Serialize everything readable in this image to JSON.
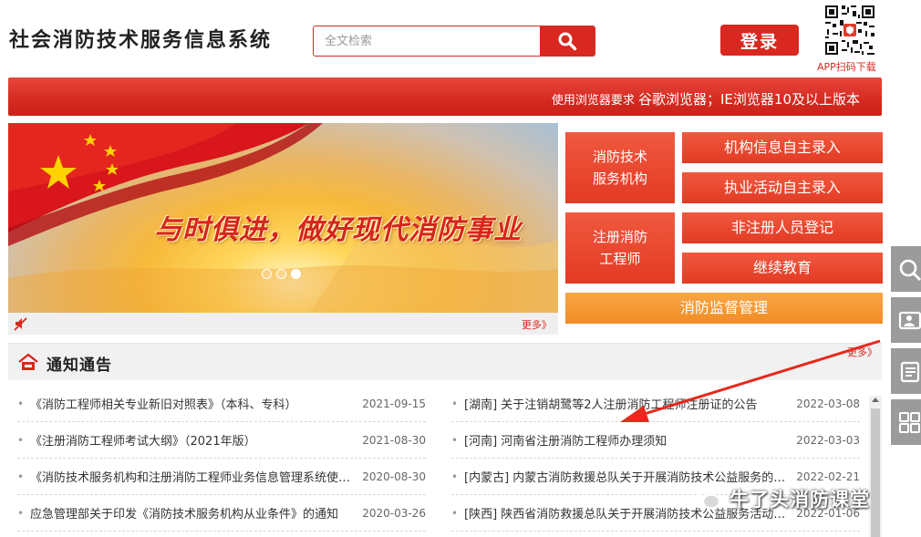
{
  "header": {
    "site_title": "社会消防技术服务信息系统",
    "search_placeholder": "全文检索",
    "login_label": "登录",
    "qr_caption": "APP扫码下载"
  },
  "banner": {
    "prefix": "使用浏览器要求",
    "browser": "谷歌浏览器",
    "suffix": "；IE浏览器10及以上版本"
  },
  "slider": {
    "slogan": "与时俱进，做好现代消防事业",
    "slide_count": 3,
    "active_index": 2,
    "more_label": "更多》"
  },
  "menu": {
    "org_group": "消防技术服务机构",
    "engineer_group": "注册消防工程师",
    "items": [
      "机构信息自主录入",
      "执业活动自主录入",
      "非注册人员登记",
      "继续教育"
    ],
    "supervision": "消防监督管理"
  },
  "notices": {
    "title": "通知通告",
    "more_label": "更多》",
    "left": [
      {
        "title": "《消防工程师相关专业新旧对照表》（本科、专科）",
        "date": "2021-09-15"
      },
      {
        "title": "《注册消防工程师考试大纲》（2021年版）",
        "date": "2021-08-30"
      },
      {
        "title": "《消防技术服务机构和注册消防工程师业务信息管理系统使用手册》",
        "date": "2020-08-30"
      },
      {
        "title": "应急管理部关于印发《消防技术服务机构从业条件》的通知",
        "date": "2020-03-26"
      }
    ],
    "right": [
      {
        "title": "[湖南] 关于注销胡鹭等2人注册消防工程师注册证的公告",
        "date": "2022-03-08"
      },
      {
        "title": "[河南] 河南省注册消防工程师办理须知",
        "date": "2022-03-03"
      },
      {
        "title": "[内蒙古] 内蒙古消防救援总队关于开展消防技术公益服务的通知",
        "date": "2022-02-21"
      },
      {
        "title": "[陕西] 陕西省消防救援总队关于开展消防技术公益服务活动的通知",
        "date": "2022-01-06"
      }
    ]
  },
  "watermark": {
    "text": "牛了头消防课堂"
  },
  "colors": {
    "brand_red": "#d9281f",
    "menu_orange": "#f18d24",
    "side_tool_gray": "#9b9b9b"
  }
}
